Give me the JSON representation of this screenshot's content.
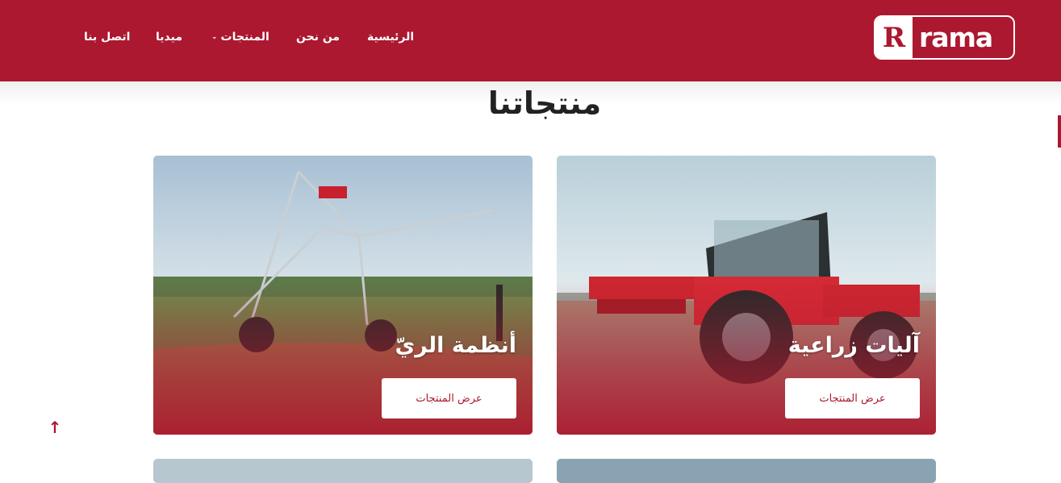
{
  "header": {
    "logo": {
      "letter": "R",
      "word": "rama"
    },
    "nav": [
      {
        "label": "الرئيسية"
      },
      {
        "label": "من نحن"
      },
      {
        "label": "المنتجات",
        "chevron": "chevron-down-icon"
      },
      {
        "label": "ميديا"
      },
      {
        "label": "اتصل بنا"
      }
    ],
    "colors": {
      "brand": "#ac182f"
    }
  },
  "main": {
    "title": "منتجاتنا",
    "cards": [
      {
        "name": "آليات زراعية",
        "button": "عرض المنتجات",
        "image": "red-tractor-spreader"
      },
      {
        "name": "أنظمة الريّ",
        "button": "عرض المنتجات",
        "image": "center-pivot-irrigation"
      }
    ]
  },
  "scroll_top": {
    "icon": "arrow-up-icon",
    "glyph": "↑"
  }
}
